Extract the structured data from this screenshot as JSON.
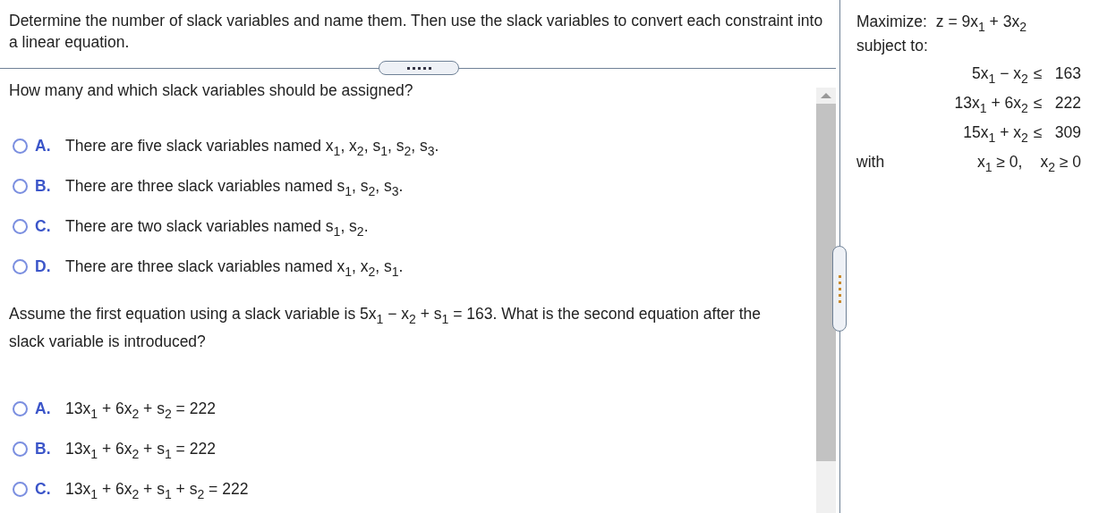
{
  "instruction": "Determine the number of slack variables and name them. Then use the slack variables to convert each constraint into a linear equation.",
  "questions": [
    {
      "prompt": "How many and which slack variables should be assigned?",
      "options": [
        {
          "letter": "A.",
          "text": "There are five slack variables named x$_{1}$, x$_{2}$, s$_{1}$, s$_{2}$, s$_{3}$.",
          "selected": false
        },
        {
          "letter": "B.",
          "text": "There are three slack variables named s$_{1}$, s$_{2}$, s$_{3}$.",
          "selected": false
        },
        {
          "letter": "C.",
          "text": "There are two slack variables named s$_{1}$, s$_{2}$.",
          "selected": false
        },
        {
          "letter": "D.",
          "text": "There are three slack variables named x$_{1}$, x$_{2}$, s$_{1}$.",
          "selected": false
        }
      ]
    },
    {
      "prompt": "Assume the first equation using a slack variable is 5x$_{1}$ − x$_{2}$ + s$_{1}$ = 163. What is the second equation after the slack variable is introduced?",
      "options": [
        {
          "letter": "A.",
          "text": "13x$_{1}$ + 6x$_{2}$ + s$_{2}$ = 222",
          "selected": false
        },
        {
          "letter": "B.",
          "text": "13x$_{1}$ + 6x$_{2}$ + s$_{1}$ = 222",
          "selected": false
        },
        {
          "letter": "C.",
          "text": "13x$_{1}$ + 6x$_{2}$ + s$_{1}$ + s$_{2}$ = 222",
          "selected": false
        }
      ]
    }
  ],
  "problem": {
    "objective_label": "Maximize:",
    "objective": "z = 9x$_{1}$ + 3x$_{2}$",
    "subject_label": "subject to:",
    "constraints": [
      {
        "lhs": "5x$_{1}$ − x$_{2}$",
        "relation": "≤",
        "rhs": "163"
      },
      {
        "lhs": "13x$_{1}$ + 6x$_{2}$",
        "relation": "≤",
        "rhs": "222"
      },
      {
        "lhs": "15x$_{1}$ + x$_{2}$",
        "relation": "≤",
        "rhs": "309"
      }
    ],
    "with_label": "with",
    "nonnegativity": [
      "x$_{1}$ ≥ 0,",
      "x$_{2}$ ≥ 0"
    ]
  }
}
